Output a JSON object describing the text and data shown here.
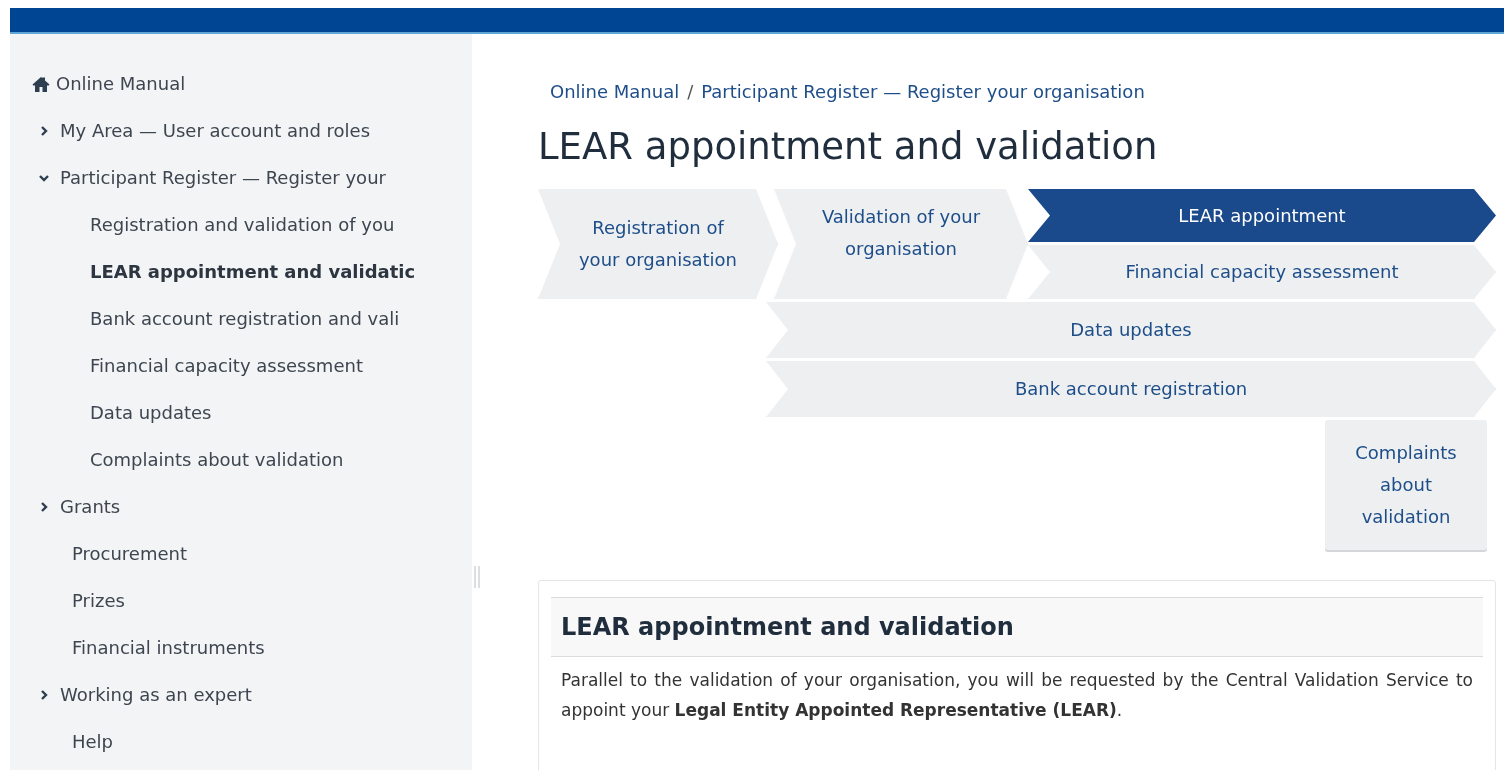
{
  "sidebar": {
    "home": {
      "label": "Online Manual"
    },
    "items": [
      {
        "label": "My Area — User account and roles",
        "expanded": false
      },
      {
        "label": "Participant Register — Register your",
        "expanded": true,
        "children": [
          {
            "label": "Registration and validation of you",
            "selected": false
          },
          {
            "label": "LEAR appointment and validatic",
            "selected": true
          },
          {
            "label": "Bank account registration and vali",
            "selected": false
          },
          {
            "label": "Financial capacity assessment",
            "selected": false
          },
          {
            "label": "Data updates",
            "selected": false
          },
          {
            "label": "Complaints about validation",
            "selected": false
          }
        ]
      },
      {
        "label": "Grants",
        "expanded": false
      },
      {
        "label": "Procurement"
      },
      {
        "label": "Prizes"
      },
      {
        "label": "Financial instruments"
      },
      {
        "label": "Working as an expert",
        "expanded": false
      },
      {
        "label": "Help"
      }
    ]
  },
  "breadcrumb_separator": "/",
  "breadcrumb": [
    "Online Manual",
    "Participant Register — Register your organisation"
  ],
  "title": "LEAR appointment and validation",
  "process_steps": [
    {
      "label": "Registration of your organisation",
      "kind": "chevron",
      "selected": false
    },
    {
      "label": "Validation of your organisation",
      "kind": "chevron",
      "selected": false
    },
    {
      "label": "LEAR appointment",
      "kind": "chevron",
      "selected": true
    },
    {
      "label": "Financial capacity assessment",
      "kind": "chevron",
      "selected": false
    },
    {
      "label": "Data updates",
      "kind": "chevron",
      "selected": false
    },
    {
      "label": "Bank account registration",
      "kind": "chevron",
      "selected": false
    },
    {
      "label": "Complaints about validation",
      "kind": "box",
      "selected": false
    }
  ],
  "section": {
    "heading": "LEAR appointment and validation",
    "text": "Parallel to the validation of your organisation, you will be requested by the Central Validation Service to appoint your **Legal Entity Appointed Representative (LEAR)**."
  }
}
